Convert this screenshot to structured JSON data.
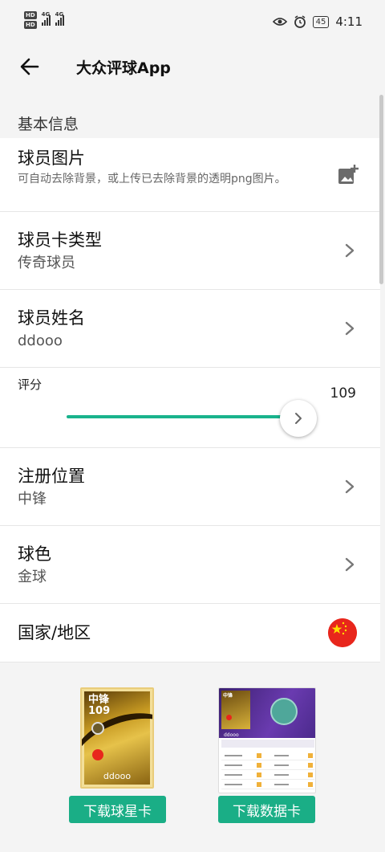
{
  "status_bar": {
    "hd1": "HD",
    "hd2": "HD",
    "signal1_label": "4G",
    "signal2_label": "4G",
    "battery": "45",
    "time": "4:11"
  },
  "toolbar": {
    "title": "大众评球App"
  },
  "section": {
    "basic_info": "基本信息"
  },
  "fields": {
    "photo": {
      "label": "球员图片",
      "hint": "可自动去除背景，或上传已去除背景的透明png图片。"
    },
    "card_type": {
      "label": "球员卡类型",
      "value": "传奇球员"
    },
    "player_name": {
      "label": "球员姓名",
      "value": "ddooo"
    },
    "rating": {
      "label": "评分",
      "value": "109"
    },
    "position": {
      "label": "注册位置",
      "value": "中锋"
    },
    "ball_color": {
      "label": "球色",
      "value": "金球"
    },
    "country": {
      "label": "国家/地区",
      "flag": "china-flag"
    }
  },
  "preview": {
    "star_card": {
      "position": "中锋",
      "rating": "109",
      "name": "ddooo"
    },
    "data_card": {
      "position": "中锋",
      "rating": "109",
      "name": "ddooo"
    }
  },
  "buttons": {
    "download_star_card": "下载球星卡",
    "download_data_card": "下载数据卡"
  },
  "colors": {
    "accent": "#1aae86",
    "slider": "#19b38c",
    "flag_red": "#e8261c"
  }
}
